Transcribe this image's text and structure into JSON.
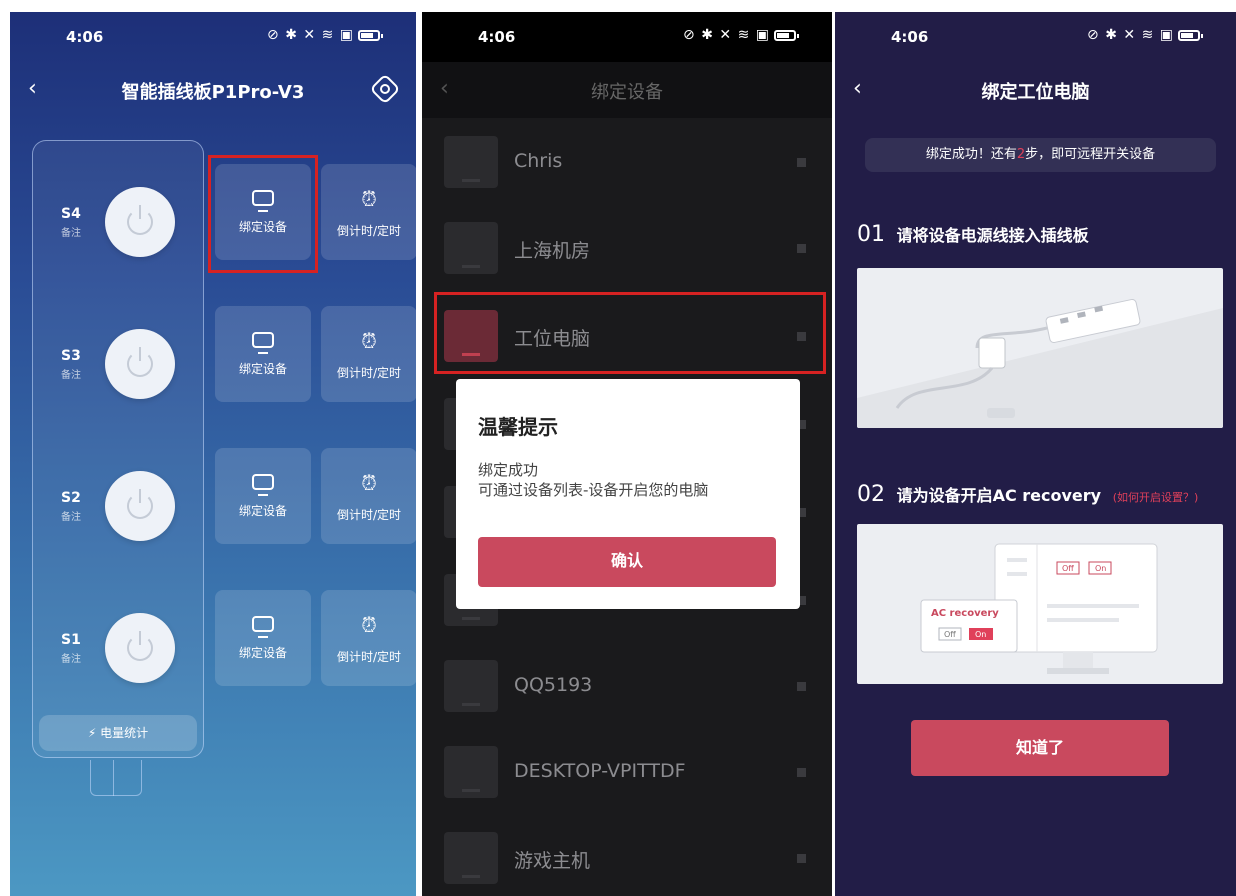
{
  "status_bar": {
    "time": "4:06",
    "icons_text": "⊘ ✱ ✕ ≋ ▣"
  },
  "panel1": {
    "title": "智能插线板P1Pro-V3",
    "sockets": [
      {
        "id": "S4",
        "note": "备注"
      },
      {
        "id": "S3",
        "note": "备注"
      },
      {
        "id": "S2",
        "note": "备注"
      },
      {
        "id": "S1",
        "note": "备注"
      }
    ],
    "bind_label": "绑定设备",
    "timer_label": "倒计时/定时",
    "energy_label": "电量统计"
  },
  "panel2": {
    "title": "绑定设备",
    "devices": [
      "Chris",
      "上海机房",
      "工位电脑",
      "QQ5193",
      "DESKTOP-VPITTDF",
      "游戏主机"
    ],
    "dialog": {
      "title": "温馨提示",
      "line1": "绑定成功",
      "line2": "可通过设备列表-设备开启您的电脑",
      "confirm": "确认"
    }
  },
  "panel3": {
    "title": "绑定工位电脑",
    "tip_before": "绑定成功！还有",
    "tip_num": "2",
    "tip_after": "步，即可远程开关设备",
    "step1_num": "01",
    "step1_text": "请将设备电源线接入插线板",
    "step2_num": "02",
    "step2_text": "请为设备开启AC recovery",
    "step2_link": "(如何开启设置？)",
    "ac_recovery_label": "AC recovery",
    "off_label": "Off",
    "on_label": "On",
    "button": "知道了"
  },
  "colors": {
    "accent": "#c9495e",
    "highlight": "#d62222",
    "panel3_bg": "#221d47"
  }
}
